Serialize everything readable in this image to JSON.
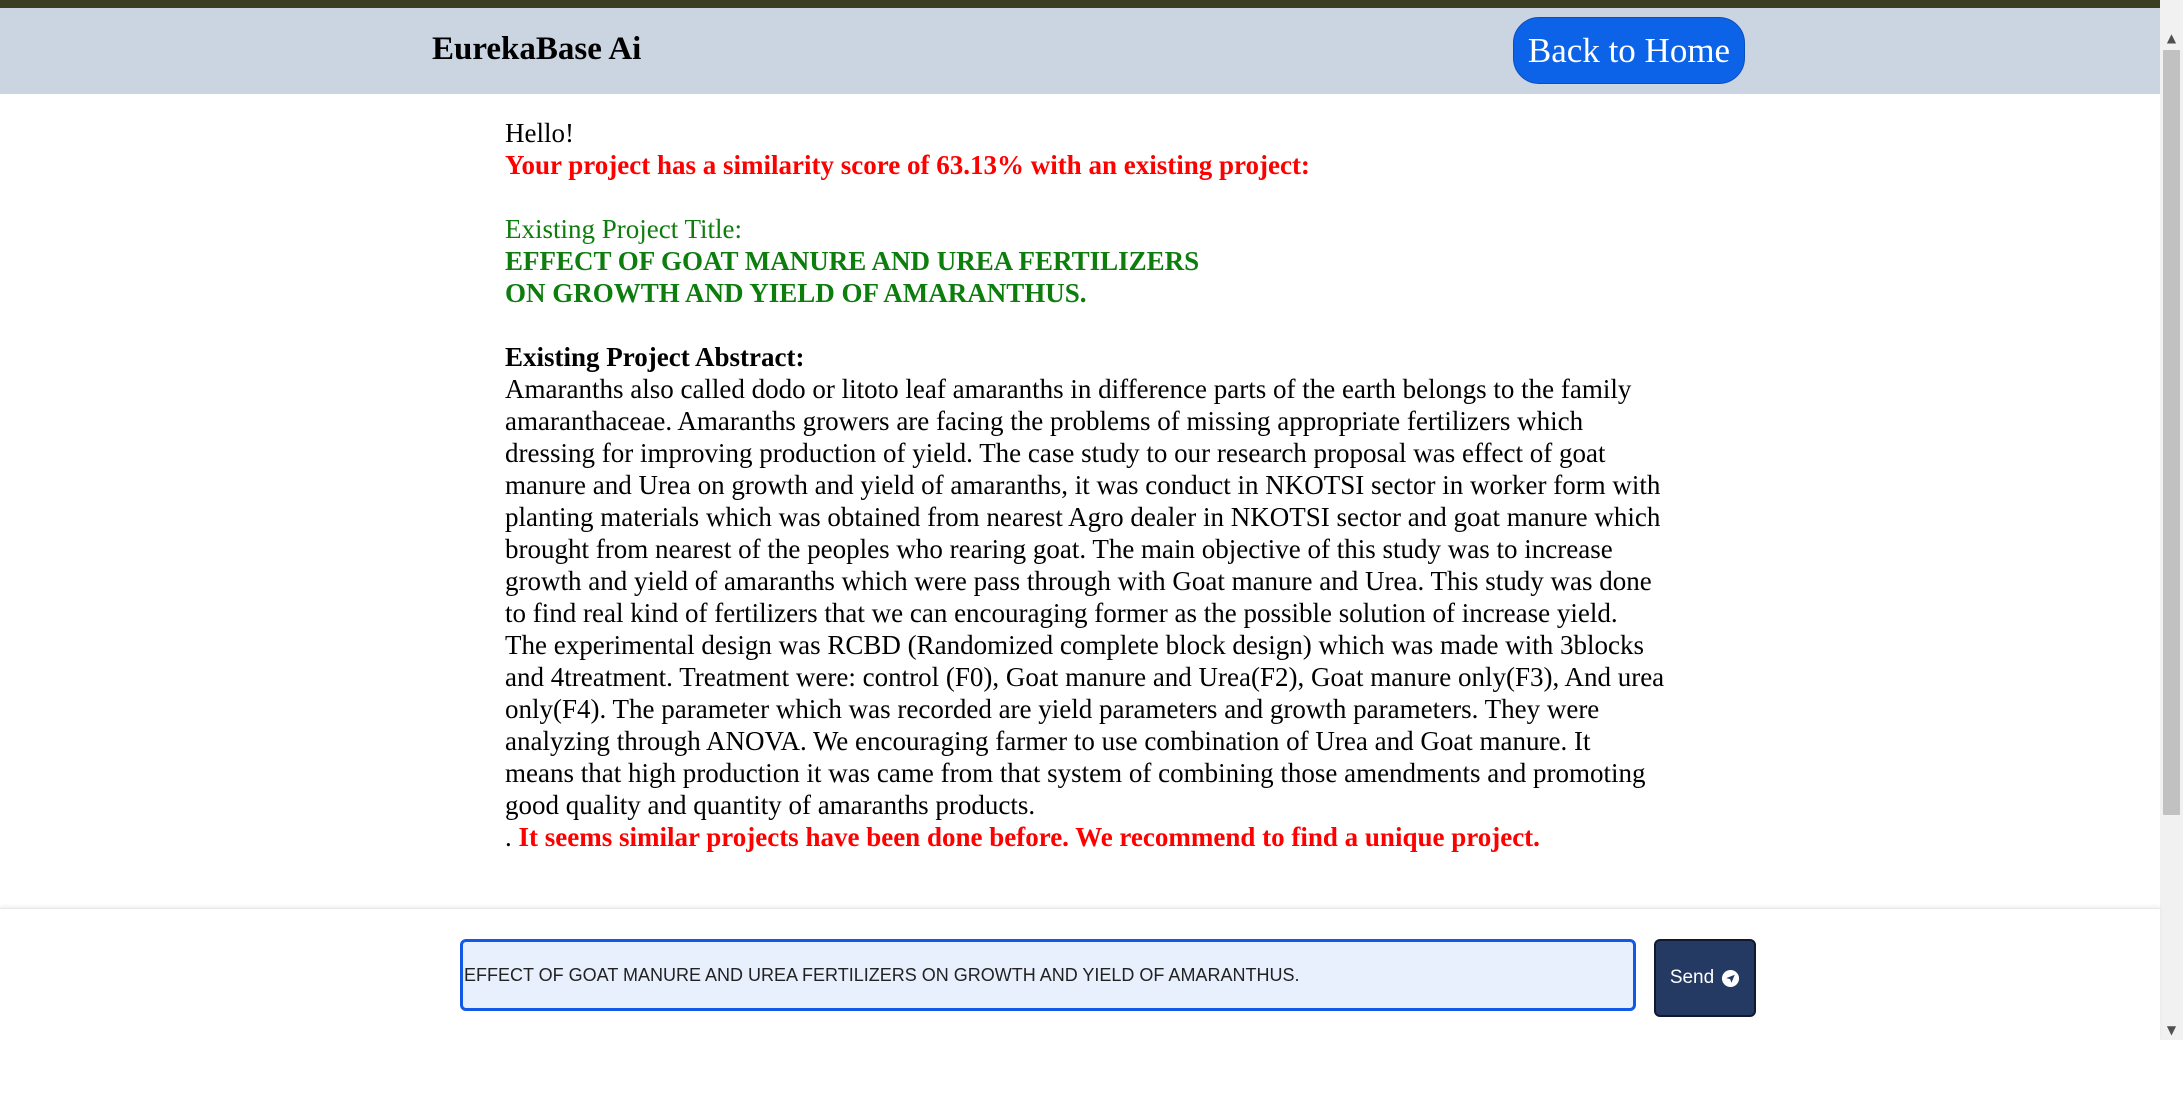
{
  "header": {
    "brand": "EurekaBase Ai",
    "back_button_label": "Back to Home"
  },
  "result": {
    "greeting": "Hello!",
    "similarity_message": "Your project has a similarity score of 63.13% with an existing project:",
    "existing_title_label": "Existing Project Title:",
    "existing_title_line1": "EFFECT OF GOAT MANURE AND UREA FERTILIZERS",
    "existing_title_line2": "ON GROWTH AND YIELD OF AMARANTHUS.",
    "abstract_label": "Existing Project Abstract:",
    "abstract_text": "Amaranths also called dodo or litoto leaf amaranths in difference parts of the earth belongs to the family amaranthaceae. Amaranths growers are facing the problems of missing appropriate fertilizers which dressing for improving production of yield. The case study to our research proposal was effect of goat manure and Urea on growth and yield of amaranths, it was conduct in NKOTSI sector in worker form with planting materials which was obtained from nearest Agro dealer in NKOTSI sector and goat manure which brought from nearest of the peoples who rearing goat. The main objective of this study was to increase growth and yield of amaranths which were pass through with Goat manure and Urea. This study was done to find real kind of fertilizers that we can encouraging former as the possible solution of increase yield. The experimental design was RCBD (Randomized complete block design) which was made with 3blocks and 4treatment. Treatment were: control (F0), Goat manure and Urea(F2), Goat manure only(F3), And urea only(F4). The parameter which was recorded are yield parameters and growth parameters. They were analyzing through ANOVA. We encouraging farmer to use combination of Urea and Goat manure. It means that high production it was came from that system of combining those amendments and promoting good quality and quantity of amaranths products.",
    "recommendation_prefix": ". ",
    "recommendation": "It seems similar projects have been done before. We recommend to find a unique project."
  },
  "input_bar": {
    "value": "EFFECT OF GOAT MANURE AND UREA FERTILIZERS ON GROWTH AND YIELD OF AMARANTHUS.",
    "send_label": "Send",
    "send_icon": "send-arrow-circle-icon"
  },
  "colors": {
    "header_bg": "#cbd5e1",
    "accent_blue": "#0d63e8",
    "warning_red": "#ff0000",
    "title_green": "#0d7d0d",
    "send_bg": "#243a63"
  }
}
